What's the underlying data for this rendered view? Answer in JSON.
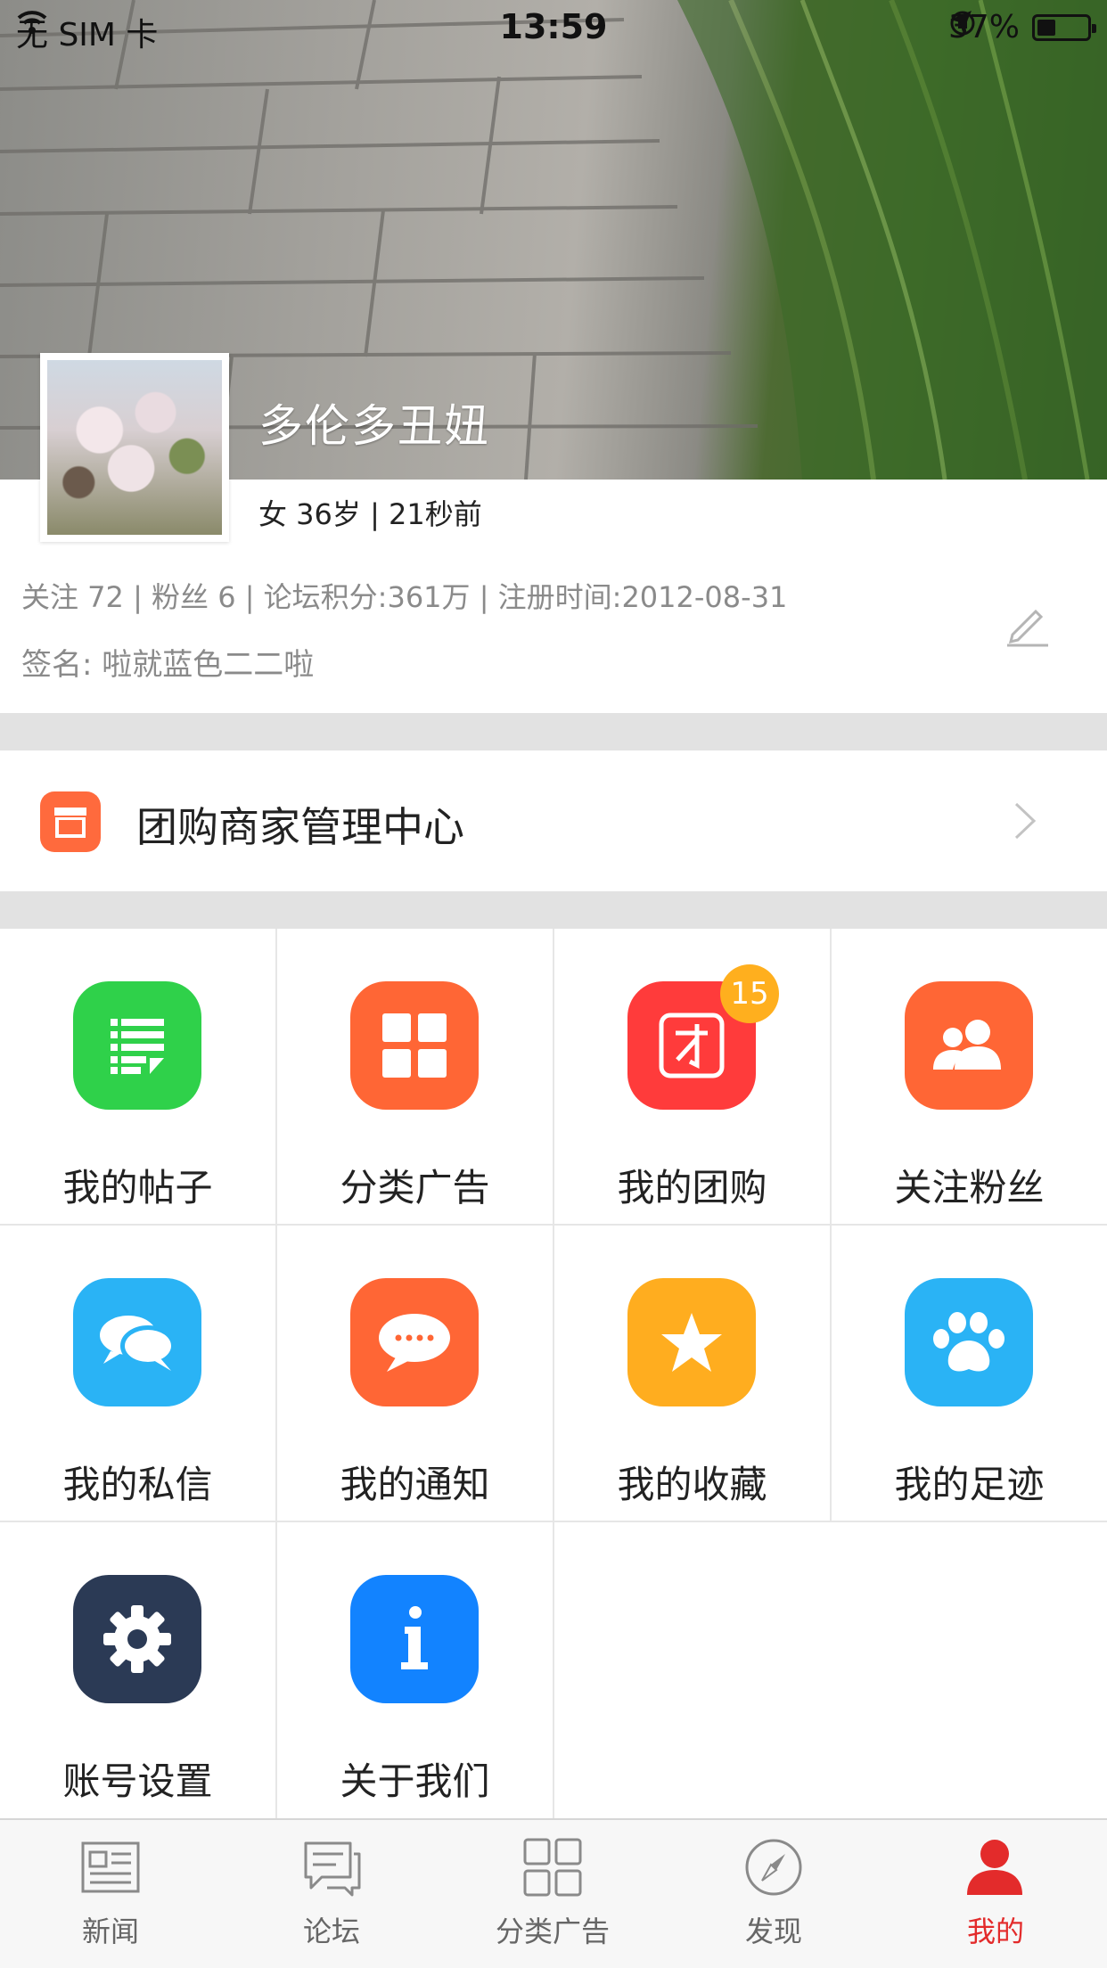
{
  "status_bar": {
    "carrier": "无 SIM 卡",
    "time": "13:59",
    "battery": "37%",
    "battery_level": 0.37
  },
  "profile": {
    "username": "多伦多丑妞",
    "meta": "女 36岁 | 21秒前",
    "stats": "关注 72 | 粉丝 6 | 论坛积分:361万 | 注册时间:2012-08-31",
    "signature": "签名: 啦就蓝色二二啦"
  },
  "merchant": {
    "label": "团购商家管理中心"
  },
  "grid": {
    "items": [
      {
        "label": "我的帖子",
        "color": "#2fd14a",
        "icon": "list-doc-icon"
      },
      {
        "label": "分类广告",
        "color": "#ff6635",
        "icon": "four-squares-icon"
      },
      {
        "label": "我的团购",
        "color": "#ff3b3b",
        "icon": "group-buy-icon",
        "badge": "15"
      },
      {
        "label": "关注粉丝",
        "color": "#ff6635",
        "icon": "people-icon"
      },
      {
        "label": "我的私信",
        "color": "#2ab3f5",
        "icon": "chat-bubbles-icon"
      },
      {
        "label": "我的通知",
        "color": "#ff6635",
        "icon": "notice-bubble-icon"
      },
      {
        "label": "我的收藏",
        "color": "#ffad1f",
        "icon": "star-icon"
      },
      {
        "label": "我的足迹",
        "color": "#2ab3f5",
        "icon": "paw-icon"
      },
      {
        "label": "账号设置",
        "color": "#2b3a55",
        "icon": "gear-icon"
      },
      {
        "label": "关于我们",
        "color": "#1283ff",
        "icon": "info-icon"
      }
    ]
  },
  "tabbar": {
    "tabs": [
      {
        "label": "新闻",
        "icon": "newspaper-icon"
      },
      {
        "label": "论坛",
        "icon": "forum-icon"
      },
      {
        "label": "分类广告",
        "icon": "grid-icon"
      },
      {
        "label": "发现",
        "icon": "compass-icon"
      },
      {
        "label": "我的",
        "icon": "user-icon",
        "active": true
      }
    ],
    "active_color": "#e32b2b"
  }
}
